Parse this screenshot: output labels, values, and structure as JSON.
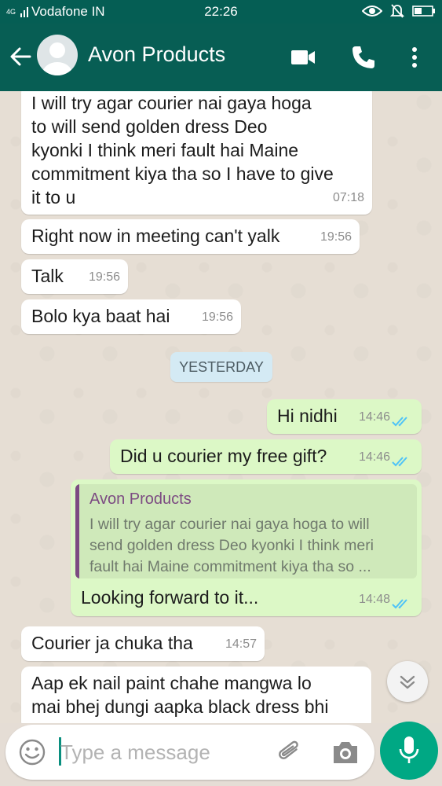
{
  "status_bar": {
    "network": "4G",
    "carrier": "Vodafone IN",
    "time": "22:26"
  },
  "header": {
    "contact_name": "Avon Products",
    "icons": [
      "back-arrow-icon",
      "avatar",
      "video-call-icon",
      "phone-icon",
      "more-vert-icon"
    ]
  },
  "messages": [
    {
      "dir": "in",
      "lines": [
        "I will try agar courier nai gaya hoga",
        "to will send golden dress Deo",
        "kyonki I think meri fault hai Maine",
        "commitment kiya tha so I have to give",
        "it to u"
      ],
      "time": "07:18"
    },
    {
      "dir": "in",
      "lines": [
        "Right now in meeting can't yalk"
      ],
      "time": "19:56"
    },
    {
      "dir": "in",
      "lines": [
        "Talk"
      ],
      "time": "19:56"
    },
    {
      "dir": "in",
      "lines": [
        "Bolo kya baat hai"
      ],
      "time": "19:56"
    },
    {
      "dir": "out",
      "lines": [
        "Hi nidhi"
      ],
      "time": "14:46",
      "status": "read"
    },
    {
      "dir": "out",
      "lines": [
        "Did u courier my free gift?"
      ],
      "time": "14:46",
      "status": "read"
    },
    {
      "dir": "out",
      "lines": [
        "Looking forward  to it..."
      ],
      "time": "14:48",
      "status": "read",
      "quote": {
        "name": "Avon Products",
        "lines": [
          "I will try agar courier nai gaya hoga to will",
          "send golden dress Deo kyonki I think meri",
          "fault hai Maine commitment kiya tha so ..."
        ]
      }
    },
    {
      "dir": "in",
      "lines": [
        "Courier ja chuka tha"
      ],
      "time": "14:57"
    },
    {
      "dir": "in",
      "lines": [
        "Aap ek nail paint chahe mangwa lo",
        "mai bhej dungi aapka black dress bhi"
      ],
      "time": ""
    }
  ],
  "day_separator": "YESTERDAY",
  "composer": {
    "placeholder": "Type a message"
  },
  "colors": {
    "header": "#075e54",
    "outgoing_bubble": "#dcf8c6",
    "incoming_bubble": "#ffffff",
    "read_ticks": "#4fc3f7",
    "mic_button": "#00a884"
  }
}
